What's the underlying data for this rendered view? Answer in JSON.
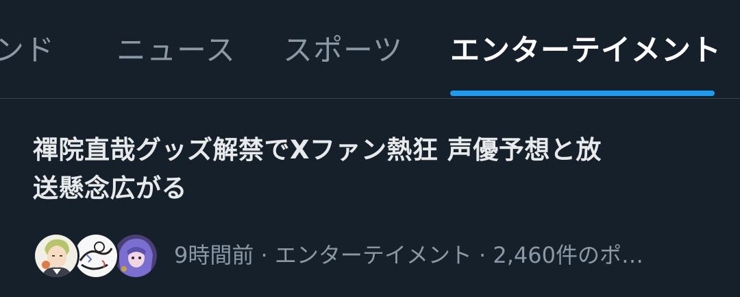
{
  "tabs": [
    {
      "label": "ンド",
      "active": false
    },
    {
      "label": "ニュース",
      "active": false
    },
    {
      "label": "スポーツ",
      "active": false
    },
    {
      "label": "エンターテイメント",
      "active": true
    }
  ],
  "story": {
    "headline_line1": "禪院直哉グッズ解禁でXファン熱狂 声優予想と放",
    "headline_line2": "送懸念広がる",
    "meta": "9時間前 · エンターテイメント · 2,460件のポ…"
  },
  "colors": {
    "background": "#15202b",
    "accent": "#1d9bf0",
    "text_primary": "#e7e9ea",
    "text_secondary": "#8b98a5",
    "divider": "#38444d"
  }
}
